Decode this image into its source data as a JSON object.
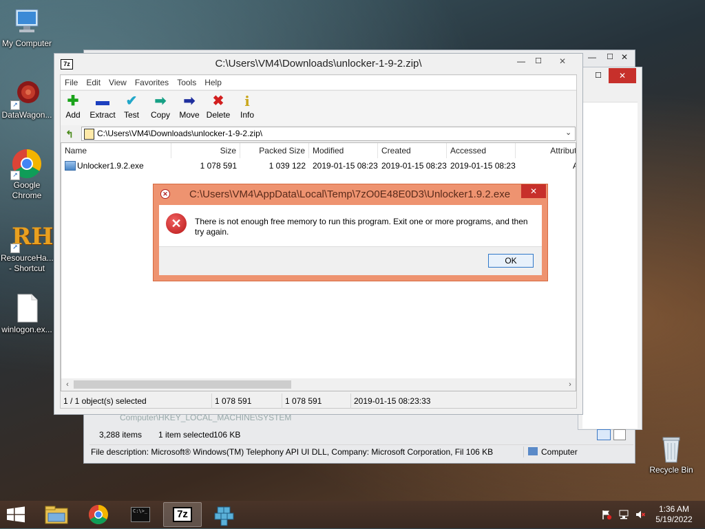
{
  "desktop": {
    "icons": [
      {
        "label": "My Computer",
        "icon": "computer-icon"
      },
      {
        "label": "DataWagon...",
        "icon": "datawagon-icon"
      },
      {
        "label": "Google Chrome",
        "icon": "chrome-icon"
      },
      {
        "label": "ResourceHa... - Shortcut",
        "icon": "resourcehacker-icon"
      },
      {
        "label": "winlogon.ex...",
        "icon": "file-icon"
      },
      {
        "label": "Recycle Bin",
        "icon": "recycle-bin-icon"
      }
    ],
    "rh_letters": "RH"
  },
  "back_window": {
    "path": "Computer\\HKEY_LOCAL_MACHINE\\SYSTEM",
    "items_count": "3,288 items",
    "selected": "1 item selected",
    "size": "106 KB",
    "file_description": "File description: Microsoft® Windows(TM) Telephony API UI DLL, Company: Microsoft Corporation, Fil 106 KB",
    "location": "Computer"
  },
  "sevenzip": {
    "app_icon_text": "7z",
    "title": "C:\\Users\\VM4\\Downloads\\unlocker-1-9-2.zip\\",
    "menu": [
      "File",
      "Edit",
      "View",
      "Favorites",
      "Tools",
      "Help"
    ],
    "toolbar": [
      {
        "label": "Add",
        "icon": "add-icon",
        "glyph": "✚",
        "color": "#1aa31a"
      },
      {
        "label": "Extract",
        "icon": "extract-icon",
        "glyph": "▬",
        "color": "#1c3fbf"
      },
      {
        "label": "Test",
        "icon": "test-icon",
        "glyph": "✔",
        "color": "#22a7c9"
      },
      {
        "label": "Copy",
        "icon": "copy-icon",
        "glyph": "➡",
        "color": "#16a085"
      },
      {
        "label": "Move",
        "icon": "move-icon",
        "glyph": "➡",
        "color": "#1f2f9e"
      },
      {
        "label": "Delete",
        "icon": "delete-icon",
        "glyph": "✖",
        "color": "#d21f1f"
      },
      {
        "label": "Info",
        "icon": "info-icon",
        "glyph": "i",
        "color": "#c9a61a"
      }
    ],
    "address": "C:\\Users\\VM4\\Downloads\\unlocker-1-9-2.zip\\",
    "columns": [
      "Name",
      "Size",
      "Packed Size",
      "Modified",
      "Created",
      "Accessed",
      "Attribute"
    ],
    "rows": [
      {
        "name": "Unlocker1.9.2.exe",
        "size": "1 078 591",
        "packed": "1 039 122",
        "modified": "2019-01-15 08:23",
        "created": "2019-01-15 08:23",
        "accessed": "2019-01-15 08:23",
        "attr": "A"
      }
    ],
    "status": [
      "1 / 1 object(s) selected",
      "1 078 591",
      "1 078 591",
      "2019-01-15 08:23:33"
    ]
  },
  "dialog": {
    "title": "C:\\Users\\VM4\\AppData\\Local\\Temp\\7zO0E48E0D3\\Unlocker1.9.2.exe",
    "message": "There is not enough free memory to run this program. Exit one or more programs, and then try again.",
    "ok_label": "OK"
  },
  "window_controls": {
    "minimize": "—",
    "maximize": "☐",
    "close": "✕"
  },
  "taskbar": {
    "time": "1:36 AM",
    "date": "5/19/2022",
    "apps": [
      "file-explorer-icon",
      "chrome-icon",
      "cmd-icon",
      "7zip-icon",
      "registry-editor-icon"
    ],
    "cmd_text": "C:\\>_",
    "sevenzip_text": "7z"
  }
}
